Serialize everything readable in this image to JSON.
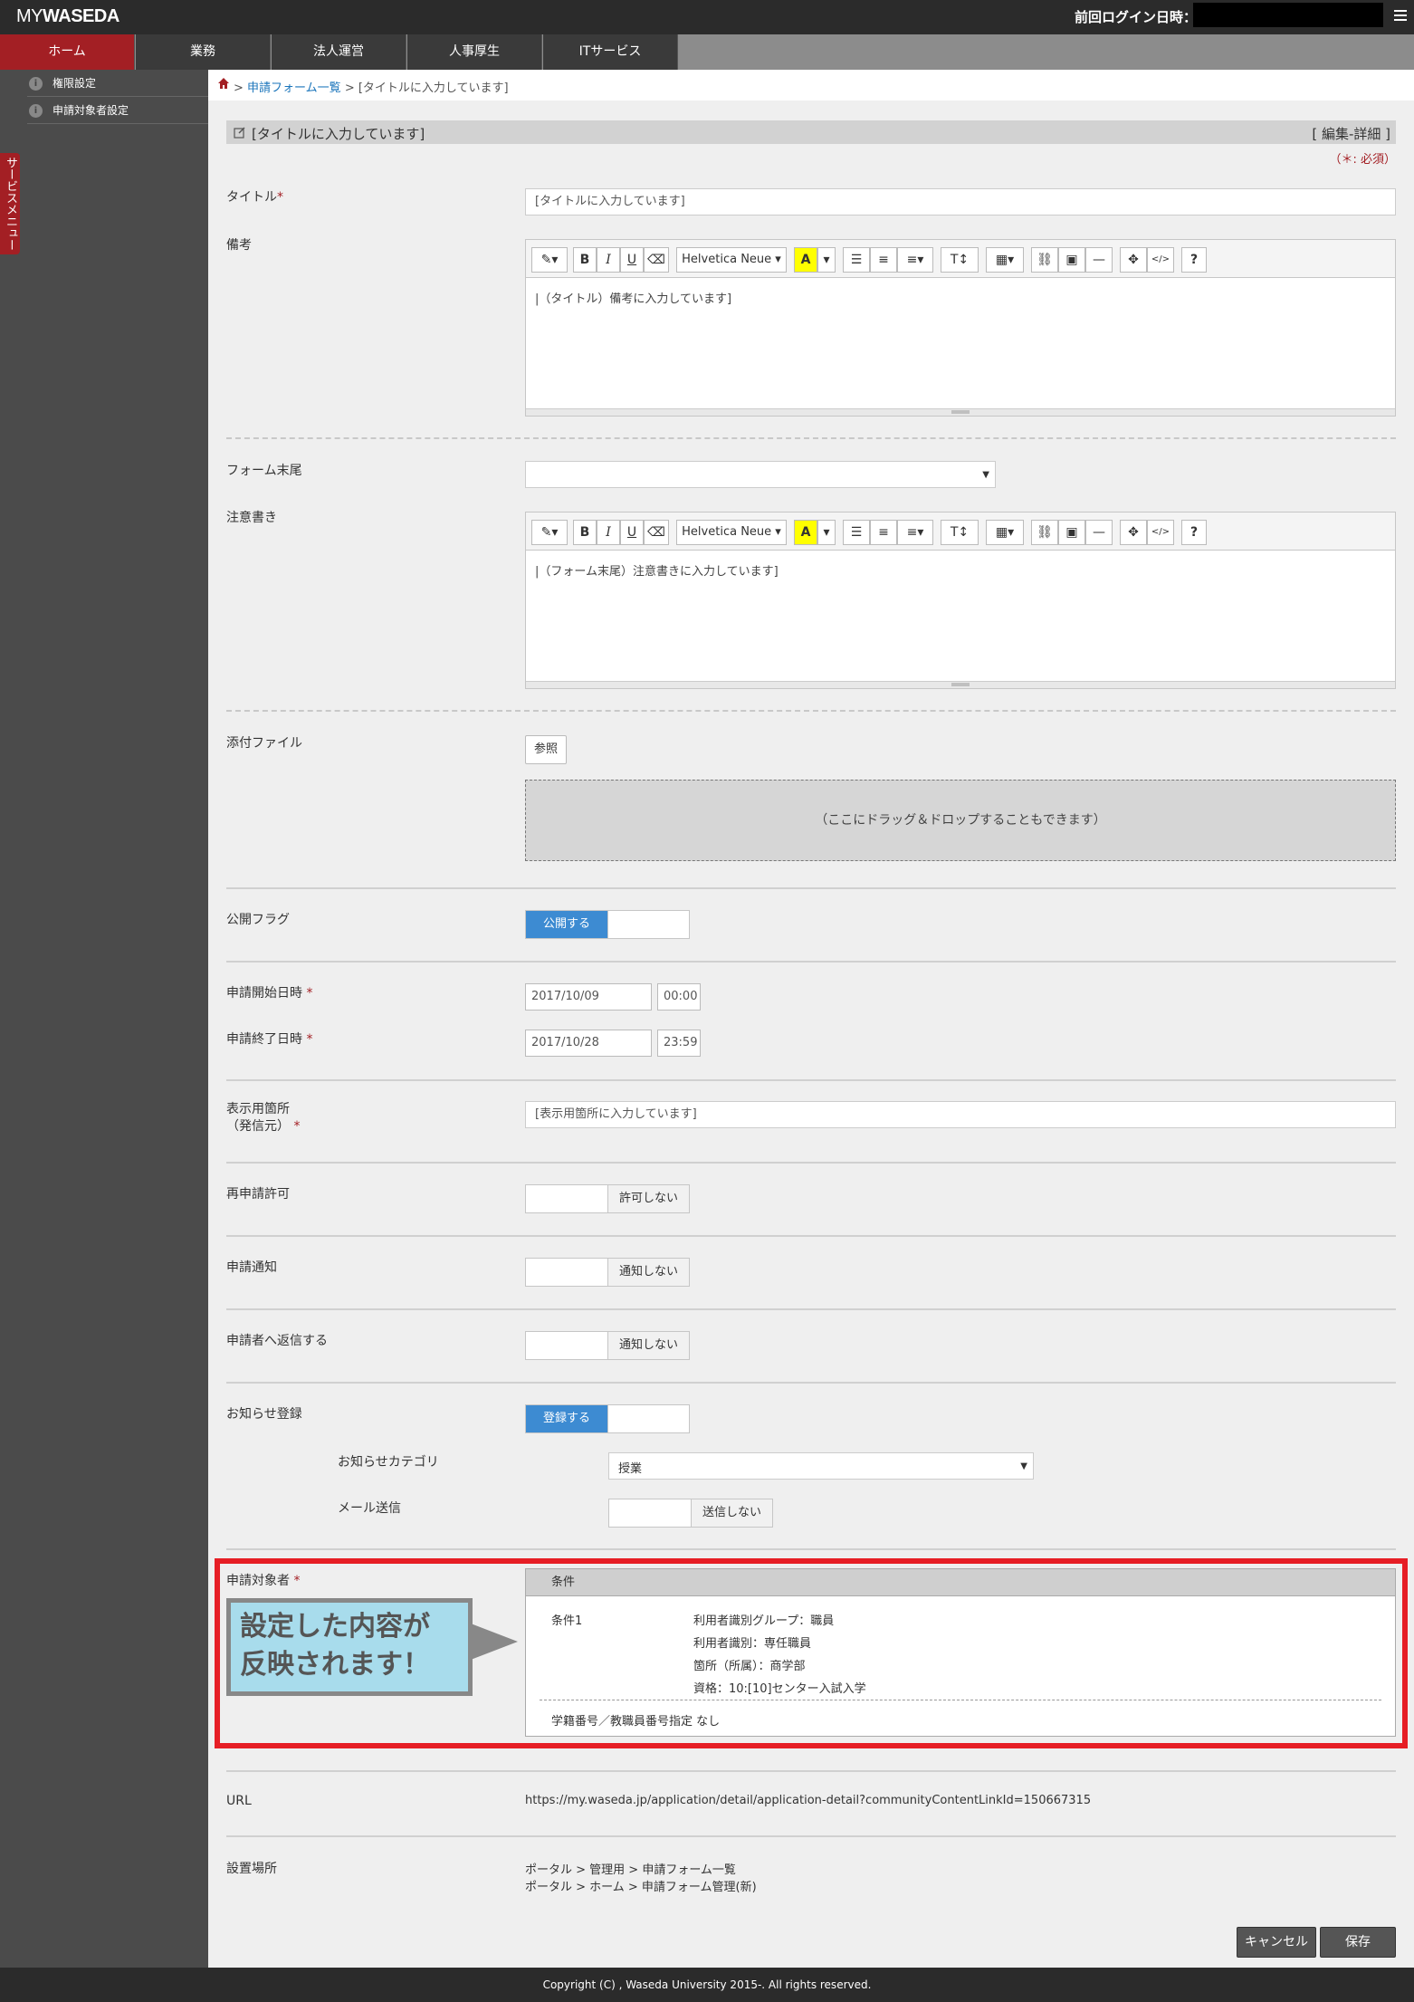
{
  "top": {
    "logo_my": "MY",
    "logo_waseda": "WASEDA",
    "last_login_label": "前回ログイン日時："
  },
  "nav": {
    "tabs": [
      {
        "label": "ホーム",
        "active": true
      },
      {
        "label": "業務"
      },
      {
        "label": "法人運営"
      },
      {
        "label": "人事厚生"
      },
      {
        "label": "ITサービス"
      }
    ]
  },
  "sidebar": {
    "items": [
      {
        "label": "権限設定"
      },
      {
        "label": "申請対象者設定"
      }
    ],
    "service_menu": "サービスメニュー"
  },
  "breadcrumb": {
    "sep": ">",
    "link": "申請フォーム一覧",
    "current": "[タイトルに入力しています]"
  },
  "header": {
    "title": "[タイトルに入力しています]",
    "right": "[ 編集-詳細 ]",
    "required_note": "（＊: 必須）"
  },
  "form": {
    "title_label": "タイトル",
    "title_value": "[タイトルに入力しています]",
    "remarks_label": "備考",
    "remarks_text": "|（タイトル）備考に入力しています]",
    "form_tail_label": "フォーム末尾",
    "notes_label": "注意書き",
    "notes_text": "|（フォーム末尾）注意書きに入力しています]",
    "attach_label": "添付ファイル",
    "browse_label": "参照",
    "dropzone_text": "（ここにドラッグ＆ドロップすることもできます）",
    "publish_label": "公開フラグ",
    "publish_on": "公開する",
    "start_label": "申請開始日時",
    "start_date": "2017/10/09",
    "start_time": "00:00",
    "end_label": "申請終了日時",
    "end_date": "2017/10/28",
    "end_time": "23:59",
    "display_label_1": "表示用箇所",
    "display_label_2": "（発信元）",
    "display_value": "[表示用箇所に入力しています]",
    "reapply_label": "再申請許可",
    "reapply_off": "許可しない",
    "notify_label": "申請通知",
    "notify_off": "通知しない",
    "reply_label": "申請者へ返信する",
    "reply_off": "通知しない",
    "news_label": "お知らせ登録",
    "news_on": "登録する",
    "news_category_label": "お知らせカテゴリ",
    "news_category_value": "授業",
    "mail_label": "メール送信",
    "mail_off": "送信しない",
    "target_label": "申請対象者",
    "asterisk": "*"
  },
  "editor_toolbar": {
    "bold": "B",
    "italic": "I",
    "underline": "U",
    "font": "Helvetica Neue",
    "highlight": "A",
    "textsize": "T↕",
    "help": "?",
    "code": "</>"
  },
  "conditions": {
    "header": "条件",
    "cond_name": "条件1",
    "lines": [
      "利用者識別グループ：職員",
      "利用者識別：専任職員",
      "箇所（所属）：商学部",
      "資格：10:[10]センター入試入学"
    ],
    "id_spec": "学籍番号／教職員番号指定 なし"
  },
  "callout": {
    "line1": "設定した内容が",
    "line2": "反映されます！"
  },
  "url": {
    "label": "URL",
    "value": "https://my.waseda.jp/application/detail/application-detail?communityContentLinkId=150667315"
  },
  "location": {
    "label": "設置場所",
    "line1": "ポータル > 管理用 > 申請フォーム一覧",
    "line2": "ポータル > ホーム > 申請フォーム管理(新)"
  },
  "actions": {
    "cancel": "キャンセル",
    "save": "保存"
  },
  "footer": {
    "copyright": "Copyright (C) , Waseda University 2015-. All rights reserved."
  },
  "colors": {
    "brand_red": "#a31f24",
    "toggle_blue": "#3d8bd2",
    "frame_red": "#e61e25"
  }
}
